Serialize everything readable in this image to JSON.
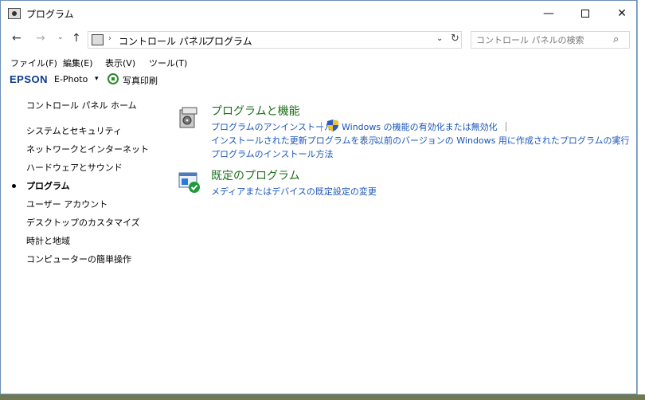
{
  "window": {
    "title": "プログラム",
    "minimize_glyph": "—",
    "close_glyph": "✕"
  },
  "nav": {
    "back_glyph": "←",
    "forward_glyph": "→",
    "recent_glyph": "⌄",
    "up_glyph": "↑",
    "breadcrumb": [
      "コントロール パネル",
      "プログラム"
    ],
    "separator": "›",
    "dropdown_glyph": "⌄",
    "refresh_glyph": "↻",
    "search_placeholder": "コントロール パネルの検索",
    "search_glyph": "⌕"
  },
  "menu": [
    "ファイル(F)",
    "編集(E)",
    "表示(V)",
    "ツール(T)"
  ],
  "epson": {
    "logo": "EPSON",
    "app": "E-Photo",
    "dropdown_glyph": "▾",
    "print_label": "写真印刷"
  },
  "sidebar": {
    "items": [
      "コントロール パネル ホーム",
      "システムとセキュリティ",
      "ネットワークとインターネット",
      "ハードウェアとサウンド",
      "プログラム",
      "ユーザー アカウント",
      "デスクトップのカスタマイズ",
      "時計と地域",
      "コンピューターの簡単操作"
    ],
    "current_index": 4
  },
  "sections": [
    {
      "title": "プログラムと機能",
      "links": [
        "プログラムのアンインストール",
        "Windows の機能の有効化または無効化",
        "インストールされた更新プログラムを表示",
        "以前のバージョンの Windows 用に作成されたプログラムの実行",
        "プログラムのインストール方法"
      ]
    },
    {
      "title": "既定のプログラム",
      "links": [
        "メディアまたはデバイスの既定設定の変更"
      ]
    }
  ],
  "colors": {
    "link": "#1a56b8",
    "section_title": "#1c6e1c",
    "window_border": "#6b8fb5"
  }
}
